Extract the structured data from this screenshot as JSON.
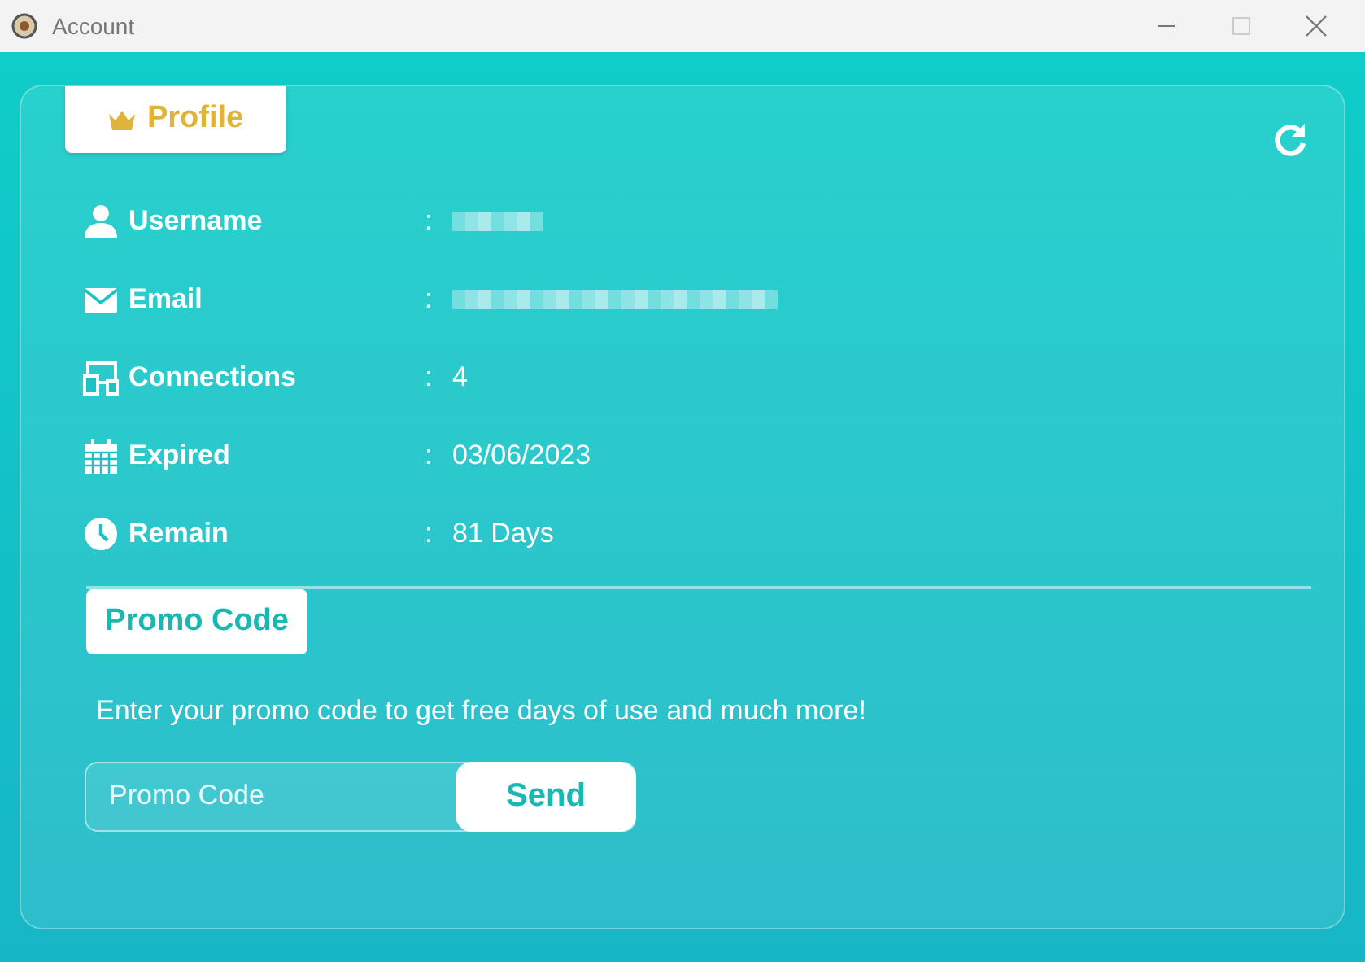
{
  "window": {
    "title": "Account"
  },
  "profile": {
    "tab": "Profile",
    "rows": [
      {
        "kind": "user",
        "label": "Username",
        "separator": ":",
        "redacted": true
      },
      {
        "kind": "email",
        "label": "Email",
        "separator": ":",
        "redacted": true
      },
      {
        "kind": "devices",
        "label": "Connections",
        "separator": ":",
        "value": "4"
      },
      {
        "kind": "calendar",
        "label": "Expired",
        "separator": ":",
        "value": "03/06/2023"
      },
      {
        "kind": "clock",
        "label": "Remain",
        "separator": ":",
        "value": "81 Days"
      }
    ]
  },
  "promo": {
    "tab": "Promo Code",
    "description": "Enter your promo code to get free days of use and much more!",
    "field": {
      "placeholder": "Promo Code"
    },
    "button": "Send"
  }
}
